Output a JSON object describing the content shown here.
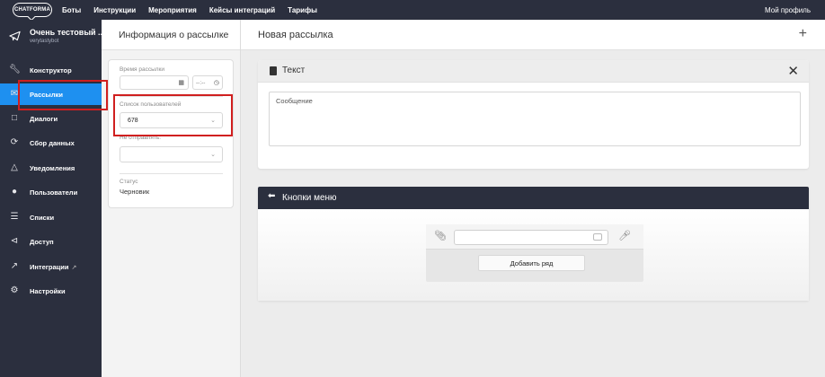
{
  "topnav": {
    "logo": "CHATFORMA",
    "items": [
      "Боты",
      "Инструкции",
      "Мероприятия",
      "Кейсы интеграций",
      "Тарифы"
    ],
    "profile": "Мой профиль"
  },
  "sidebar": {
    "bot_name": "Очень тестовый ...",
    "bot_username": "verytastybot",
    "items": [
      {
        "label": "Конструктор",
        "icon": "wrench-icon"
      },
      {
        "label": "Рассылки",
        "icon": "mail-icon",
        "active": true
      },
      {
        "label": "Диалоги",
        "icon": "chat-icon"
      },
      {
        "label": "Сбор данных",
        "icon": "refresh-icon"
      },
      {
        "label": "Уведомления",
        "icon": "bell-icon"
      },
      {
        "label": "Пользователи",
        "icon": "users-icon"
      },
      {
        "label": "Списки",
        "icon": "list-icon"
      },
      {
        "label": "Доступ",
        "icon": "share-icon"
      },
      {
        "label": "Интеграции",
        "icon": "plug-icon"
      },
      {
        "label": "Настройки",
        "icon": "gear-icon"
      }
    ],
    "accent": "#1e90f0",
    "background": "#2b2f3e"
  },
  "info_panel": {
    "title": "Информация о рассылке",
    "send_time_label": "Время рассылки",
    "time_placeholder": "--:--",
    "user_list_label": "Список пользователей",
    "user_list_value": "678",
    "dont_send_label": "Не отправлять:",
    "status_label": "Статус",
    "status_value": "Черновик"
  },
  "main": {
    "title": "Новая рассылка",
    "text_block": {
      "title": "Текст",
      "placeholder": "Сообщение"
    },
    "menu_block": {
      "title": "Кнопки меню",
      "add_row_label": "Добавить ряд"
    }
  },
  "highlight_color": "#d01f1f"
}
